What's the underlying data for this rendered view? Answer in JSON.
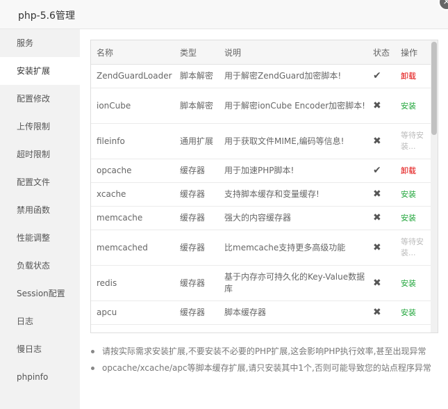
{
  "window": {
    "title": "php-5.6管理",
    "close_icon": "×"
  },
  "sidebar": {
    "items": [
      {
        "label": "服务"
      },
      {
        "label": "安装扩展"
      },
      {
        "label": "配置修改"
      },
      {
        "label": "上传限制"
      },
      {
        "label": "超时限制"
      },
      {
        "label": "配置文件"
      },
      {
        "label": "禁用函数"
      },
      {
        "label": "性能调整"
      },
      {
        "label": "负载状态"
      },
      {
        "label": "Session配置"
      },
      {
        "label": "日志"
      },
      {
        "label": "慢日志"
      },
      {
        "label": "phpinfo"
      }
    ],
    "active": "安装扩展"
  },
  "table": {
    "headers": [
      "名称",
      "类型",
      "说明",
      "状态",
      "操作"
    ],
    "rows": [
      {
        "name": "ZendGuardLoader",
        "type": "脚本解密",
        "desc": "用于解密ZendGuard加密脚本!",
        "status": "✔",
        "op": "卸载",
        "op_kind": "uninstall"
      },
      {
        "name": "ionCube",
        "type": "脚本解密",
        "desc": "用于解密ionCube Encoder加密脚本!",
        "status": "✖",
        "op": "安装",
        "op_kind": "install"
      },
      {
        "name": "fileinfo",
        "type": "通用扩展",
        "desc": "用于获取文件MIME,编码等信息!",
        "status": "✖",
        "op": "等待安装...",
        "op_kind": "waiting"
      },
      {
        "name": "opcache",
        "type": "缓存器",
        "desc": "用于加速PHP脚本!",
        "status": "✔",
        "op": "卸载",
        "op_kind": "uninstall"
      },
      {
        "name": "xcache",
        "type": "缓存器",
        "desc": "支持脚本缓存和变量缓存!",
        "status": "✖",
        "op": "安装",
        "op_kind": "install"
      },
      {
        "name": "memcache",
        "type": "缓存器",
        "desc": "强大的内容缓存器",
        "status": "✖",
        "op": "安装",
        "op_kind": "install"
      },
      {
        "name": "memcached",
        "type": "缓存器",
        "desc": "比memcache支持更多高级功能",
        "status": "✖",
        "op": "等待安装...",
        "op_kind": "waiting"
      },
      {
        "name": "redis",
        "type": "缓存器",
        "desc": "基于内存亦可持久化的Key-Value数据库",
        "status": "✖",
        "op": "安装",
        "op_kind": "install"
      },
      {
        "name": "apcu",
        "type": "缓存器",
        "desc": "脚本缓存器",
        "status": "✖",
        "op": "安装",
        "op_kind": "install"
      }
    ]
  },
  "notes": [
    "请按实际需求安装扩展,不要安装不必要的PHP扩展,这会影响PHP执行效率,甚至出现异常",
    "opcache/xcache/apc等脚本缓存扩展,请只安装其中1个,否则可能导致您的站点程序异常"
  ],
  "colors": {
    "install": "#20a53a",
    "uninstall": "#e00000",
    "waiting": "#bbbbbb"
  }
}
